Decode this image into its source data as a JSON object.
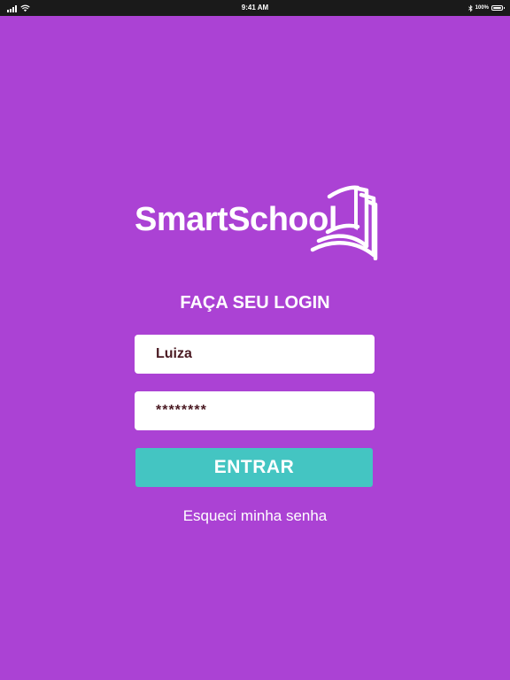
{
  "status_bar": {
    "time": "9:41 AM",
    "battery": "100%",
    "signal_icon": "cellular-signal-icon",
    "wifi_icon": "wifi-icon",
    "bluetooth_icon": "bluetooth-icon",
    "battery_icon": "battery-icon",
    "battery_level": 1.0
  },
  "logo": {
    "text": "SmartSchool",
    "icon": "open-book-icon"
  },
  "login": {
    "title": "FAÇA SEU LOGIN",
    "username_value": "Luiza",
    "password_value": "********",
    "submit_label": "ENTRAR",
    "forgot_label": "Esqueci minha senha"
  },
  "colors": {
    "background": "#ab42d4",
    "button": "#44c5c2",
    "field_text": "#4a1a22",
    "status_bar": "#1a1a1a"
  }
}
